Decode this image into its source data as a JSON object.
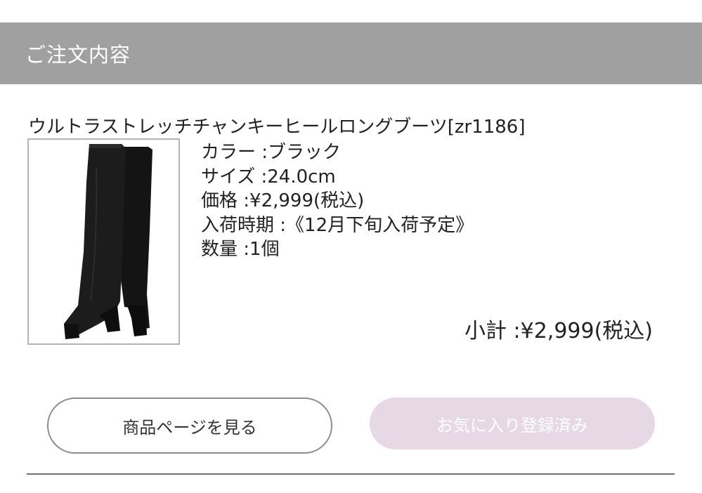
{
  "section": {
    "title": "ご注文内容"
  },
  "product": {
    "name": "ウルトラストレッチチャンキーヒールロングブーツ[zr1186]",
    "image_alt": "black knee-high chunky heel boots",
    "details": [
      "カラー :ブラック",
      "サイズ :24.0cm",
      "価格 :¥2,999(税込)",
      "入荷時期 :《12月下旬入荷予定》",
      "数量 :1個"
    ],
    "subtotal": "小計 :¥2,999(税込)"
  },
  "actions": {
    "view_product_label": "商品ページを見る",
    "favorite_label": "お気に入り登録済み"
  },
  "colors": {
    "header_bg": "#a0a0a0",
    "favorite_bg": "#e6d8e5",
    "button_border": "#8c8c8c"
  }
}
